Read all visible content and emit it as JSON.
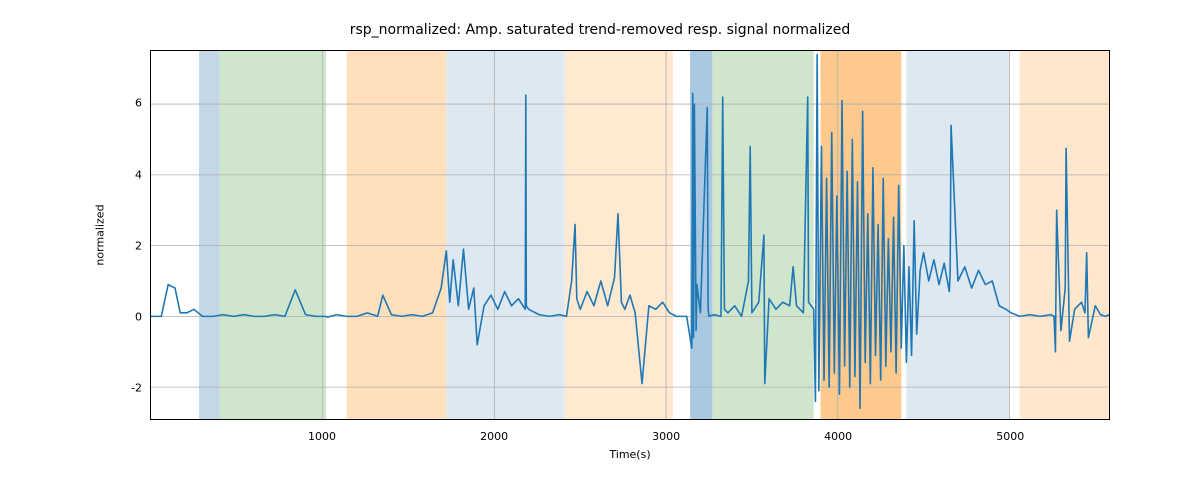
{
  "chart_data": {
    "type": "line",
    "title": "rsp_normalized: Amp. saturated trend-removed resp. signal normalized",
    "xlabel": "Time(s)",
    "ylabel": "normalized",
    "xlim": [
      0,
      5580
    ],
    "ylim": [
      -2.9,
      7.5
    ],
    "yticks": [
      -2,
      0,
      2,
      4,
      6
    ],
    "xticks": [
      1000,
      2000,
      3000,
      4000,
      5000
    ],
    "line_color": "#1f77b4",
    "regions": [
      {
        "start": 280,
        "end": 400,
        "fill": "#c3d7e7"
      },
      {
        "start": 400,
        "end": 1020,
        "fill": "#cfe6cd"
      },
      {
        "start": 1140,
        "end": 1720,
        "fill": "#ffdfbc"
      },
      {
        "start": 1720,
        "end": 2410,
        "fill": "#dde8f1"
      },
      {
        "start": 2410,
        "end": 3040,
        "fill": "#ffe9d1"
      },
      {
        "start": 3140,
        "end": 3270,
        "fill": "#a9c8e2"
      },
      {
        "start": 3270,
        "end": 3860,
        "fill": "#cfe6cd"
      },
      {
        "start": 3900,
        "end": 4370,
        "fill": "#fdc98c"
      },
      {
        "start": 4400,
        "end": 5000,
        "fill": "#dde8f1"
      },
      {
        "start": 5060,
        "end": 5580,
        "fill": "#ffe7cd"
      }
    ],
    "x": [
      0,
      60,
      100,
      140,
      170,
      210,
      250,
      300,
      360,
      420,
      480,
      540,
      600,
      660,
      720,
      780,
      840,
      900,
      960,
      1015,
      1030,
      1080,
      1140,
      1200,
      1260,
      1320,
      1350,
      1400,
      1460,
      1520,
      1580,
      1640,
      1690,
      1720,
      1740,
      1760,
      1790,
      1820,
      1850,
      1880,
      1900,
      1940,
      1980,
      2020,
      2060,
      2100,
      2140,
      2180,
      2183,
      2186,
      2200,
      2260,
      2320,
      2380,
      2420,
      2450,
      2470,
      2480,
      2500,
      2540,
      2580,
      2620,
      2660,
      2700,
      2720,
      2740,
      2760,
      2790,
      2820,
      2860,
      2900,
      2940,
      2980,
      3020,
      3060,
      3120,
      3150,
      3155,
      3160,
      3165,
      3175,
      3180,
      3200,
      3240,
      3245,
      3250,
      3280,
      3320,
      3330,
      3340,
      3360,
      3400,
      3440,
      3480,
      3490,
      3500,
      3540,
      3570,
      3575,
      3600,
      3640,
      3680,
      3720,
      3740,
      3760,
      3800,
      3825,
      3830,
      3860,
      3870,
      3880,
      3890,
      3905,
      3920,
      3935,
      3950,
      3965,
      3980,
      3995,
      4010,
      4025,
      4040,
      4055,
      4070,
      4085,
      4100,
      4115,
      4130,
      4145,
      4160,
      4175,
      4190,
      4205,
      4220,
      4235,
      4250,
      4265,
      4280,
      4295,
      4310,
      4325,
      4340,
      4355,
      4370,
      4385,
      4400,
      4415,
      4430,
      4445,
      4460,
      4480,
      4500,
      4530,
      4560,
      4590,
      4620,
      4650,
      4655,
      4660,
      4700,
      4740,
      4780,
      4820,
      4860,
      4900,
      4940,
      4980,
      5010,
      5060,
      5120,
      5180,
      5240,
      5260,
      5268,
      5275,
      5300,
      5325,
      5330,
      5350,
      5380,
      5420,
      5440,
      5450,
      5460,
      5500,
      5530,
      5560,
      5580
    ],
    "y": [
      0,
      0,
      0.9,
      0.8,
      0.1,
      0.1,
      0.2,
      0.0,
      0.0,
      0.05,
      0.0,
      0.05,
      0.0,
      0.0,
      0.05,
      0.0,
      0.75,
      0.05,
      0.0,
      0.0,
      -0.02,
      0.05,
      0.0,
      0.0,
      0.1,
      0.0,
      0.6,
      0.05,
      0.0,
      0.05,
      0.0,
      0.1,
      0.8,
      1.85,
      0.4,
      1.6,
      0.3,
      1.9,
      0.2,
      0.8,
      -0.8,
      0.3,
      0.6,
      0.2,
      0.7,
      0.3,
      0.5,
      0.2,
      6.25,
      0.3,
      0.2,
      0.05,
      0.0,
      0.05,
      0.0,
      1.0,
      2.6,
      0.5,
      0.2,
      0.7,
      0.3,
      1.0,
      0.3,
      1.1,
      2.9,
      0.4,
      0.2,
      0.6,
      0.1,
      -1.9,
      0.3,
      0.2,
      0.4,
      0.1,
      0.0,
      0.0,
      -0.9,
      6.3,
      -0.6,
      6.0,
      -0.4,
      0.9,
      0.1,
      5.9,
      0.2,
      0.0,
      0.05,
      0.0,
      6.2,
      0.2,
      0.1,
      0.3,
      0.0,
      1.0,
      4.8,
      0.1,
      0.4,
      2.3,
      -1.9,
      0.5,
      0.2,
      0.4,
      0.3,
      1.4,
      0.3,
      0.1,
      6.2,
      0.4,
      0.2,
      -2.4,
      7.4,
      -2.1,
      4.8,
      -1.8,
      3.9,
      -2.0,
      5.2,
      -1.6,
      3.4,
      -2.2,
      6.1,
      -1.4,
      4.1,
      -2.0,
      5.0,
      -1.7,
      3.8,
      -2.6,
      5.8,
      -1.3,
      2.9,
      -1.9,
      4.2,
      -1.1,
      2.6,
      -1.8,
      3.9,
      -1.4,
      2.2,
      -1.0,
      2.8,
      -1.6,
      3.7,
      -0.9,
      2.0,
      -1.3,
      1.4,
      -1.1,
      2.7,
      -0.5,
      1.3,
      1.8,
      1.0,
      1.6,
      0.9,
      1.5,
      0.7,
      1.3,
      5.4,
      1.0,
      1.4,
      0.8,
      1.3,
      0.9,
      1.0,
      0.3,
      0.2,
      0.1,
      0.0,
      0.05,
      0.0,
      0.05,
      0.0,
      -1.0,
      3.0,
      -0.4,
      0.8,
      4.75,
      -0.7,
      0.2,
      0.4,
      0.1,
      1.8,
      -0.6,
      0.3,
      0.05,
      0.0,
      0.05,
      0.02
    ]
  }
}
